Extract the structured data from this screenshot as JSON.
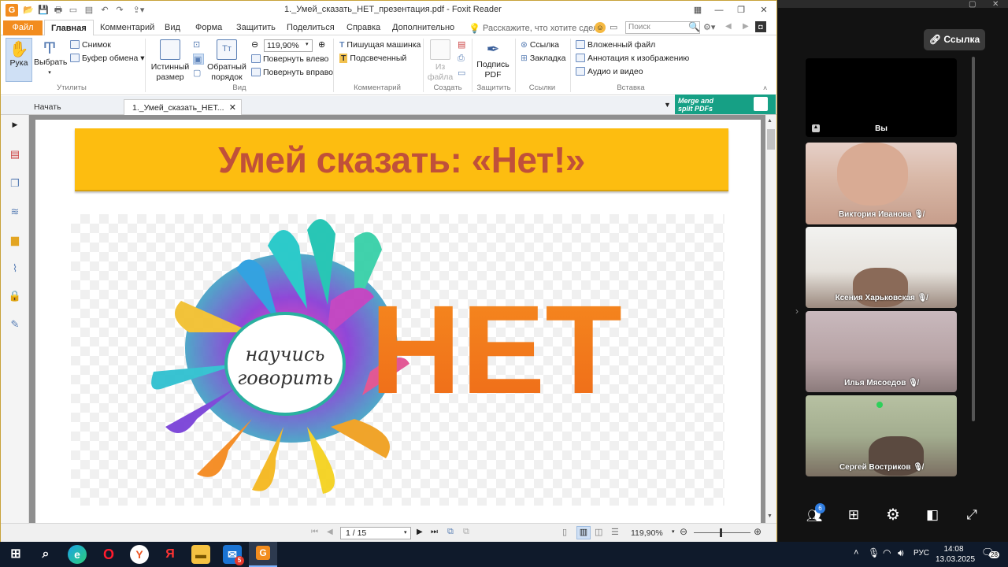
{
  "window": {
    "title": "1._Умей_сказать_НЕТ_презентация.pdf - Foxit Reader",
    "controls": [
      "minimize",
      "restore",
      "close"
    ]
  },
  "menu_tabs": {
    "file": "Файл",
    "items": [
      "Главная",
      "Комментарий",
      "Вид",
      "Форма",
      "Защитить",
      "Поделиться",
      "Справка",
      "Дополнительно"
    ],
    "active": "Главная",
    "tell_me": "Расскажите, что хотите сдел",
    "search_placeholder": "Поиск"
  },
  "ribbon": {
    "hand": "Рука",
    "select": "Выбрать",
    "snapshot": "Снимок",
    "clipboard": "Буфер обмена",
    "group_utils": "Утилиты",
    "actual_size_1": "Истинный",
    "actual_size_2": "размер",
    "reverse_order_1": "Обратный",
    "reverse_order_2": "порядок",
    "zoom_value": "119,90%",
    "rotate_left": "Повернуть влево",
    "rotate_right": "Повернуть вправо",
    "group_view": "Вид",
    "typewriter": "Пишущая машинка",
    "highlight": "Подсвеченный",
    "group_comment": "Комментарий",
    "from_file_1": "Из",
    "from_file_2": "файла",
    "group_create": "Создать",
    "sign_pdf_1": "Подпись",
    "sign_pdf_2": "PDF",
    "group_protect": "Защитить",
    "link": "Ссылка",
    "bookmark": "Закладка",
    "group_links": "Ссылки",
    "attached_file": "Вложенный файл",
    "image_annotation": "Аннотация к изображению",
    "audio_video": "Аудио и видео",
    "group_insert": "Вставка"
  },
  "doc_tabs": {
    "start": "Начать",
    "current": "1._Умей_сказать_НЕТ...",
    "promo_1": "Merge and",
    "promo_2": "split PDFs"
  },
  "slide": {
    "title": "Умей сказать: «Нет!»",
    "logo_word": "НЕТ",
    "logo_circle_1": "научись",
    "logo_circle_2": "говорить"
  },
  "status": {
    "page": "1 / 15",
    "zoom": "119,90%"
  },
  "meeting": {
    "link_button": "Ссылка",
    "participants": [
      {
        "name": "Вы",
        "video": false
      },
      {
        "name": "Виктория Иванова",
        "video": true
      },
      {
        "name": "Ксения Харьковская",
        "video": true
      },
      {
        "name": "Илья Мясоедов",
        "video": true
      },
      {
        "name": "Сергей Востриков",
        "video": true
      }
    ],
    "participants_badge": "6"
  },
  "taskbar": {
    "lang": "РУС",
    "time": "14:08",
    "date": "13.03.2025",
    "notifications": "28",
    "mail_badge": "5"
  },
  "colors": {
    "foxit_accent": "#f28c1e",
    "banner_yellow": "#fdbd10",
    "title_red": "#c0503a",
    "net_orange": "#f07f1b",
    "promo_green": "#16a085"
  }
}
